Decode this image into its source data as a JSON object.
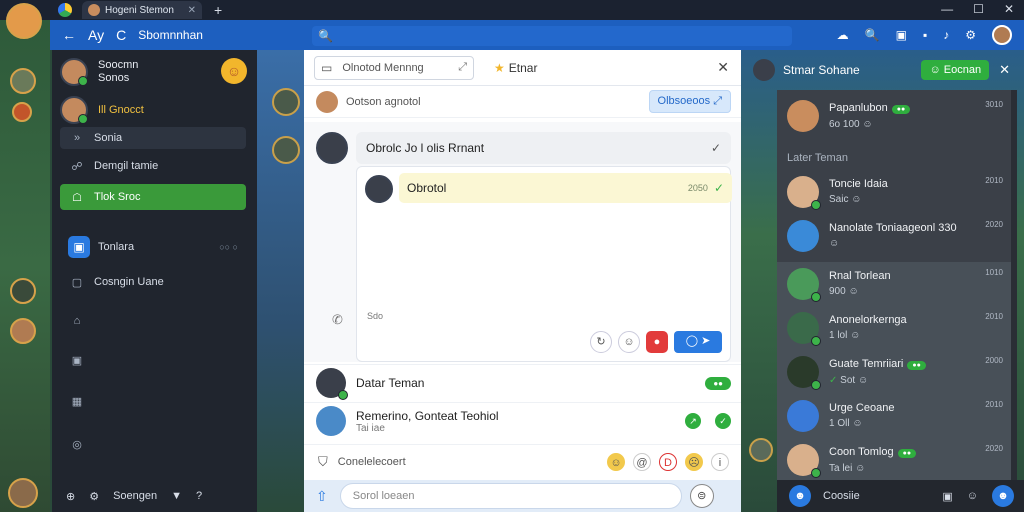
{
  "titlebar": {
    "tab_title": "Hogeni Stemon",
    "tab_close": "✕",
    "new_tab": "+",
    "controls": [
      "—",
      "☐",
      "✕"
    ]
  },
  "navbar": {
    "back": "←",
    "title_prefix": "Ay",
    "refresh": "C",
    "title": "Sbomnnhan",
    "search_icon": "🔍",
    "right_icons": [
      "☁",
      "🔍",
      "▣",
      "▪",
      "▪",
      "♪",
      "⚙"
    ]
  },
  "sidebar": {
    "user_name_line1": "Soocmn",
    "user_name_line2": "Sonos",
    "status_label": "Ill Gnocct",
    "items": [
      {
        "label": "Sonia",
        "icon": "»"
      },
      {
        "label": "Demgil tamie",
        "icon": "☍"
      },
      {
        "label": "Tlok Sroc",
        "icon": "☖"
      },
      {
        "label": "Tonlara",
        "icon": "▣",
        "meta": "○○ ○"
      },
      {
        "label": "Cosngin Uane",
        "icon": "▢"
      }
    ],
    "bottom_label": "Soengen"
  },
  "chat": {
    "header_box": "Olnotod Mennng",
    "header_star": "Etnar",
    "subheader_text": "Ootson agnotol",
    "subheader_pill": "Olbsoeoos",
    "top_message": "Obrolc Jo l olis Rrnant",
    "reply_text": "Obrotol",
    "reply_time": "2050",
    "small_text": "Sdo",
    "friend_list_title": "Datar Teman",
    "friend2_name": "Remerino, Gonteat Teohiol",
    "friend2_sub": "Tai iae",
    "toolbar_label": "Conelelecoert",
    "input_placeholder": "Sorol loeaen"
  },
  "right_panel": {
    "title": "Stmar Sohane",
    "header_button": "Eocnan",
    "section_label": "Later Teman",
    "contacts": [
      {
        "name": "Papanlubon",
        "sub": "6o 100",
        "time": "3010"
      },
      {
        "name": "Toncie Idaia",
        "sub": "Saic",
        "time": "2010"
      },
      {
        "name": "Nanolate Toniaageonl 330",
        "sub": "",
        "time": "2020"
      },
      {
        "name": "Rnal Torlean",
        "sub": "900",
        "time": "1010"
      },
      {
        "name": "Anonelorkernga",
        "sub": "1 lol",
        "time": "2010"
      },
      {
        "name": "Guate Temriiari",
        "sub": "Sot",
        "time": "2000"
      },
      {
        "name": "Urge Ceoane",
        "sub": "1 Oll",
        "time": "2010"
      },
      {
        "name": "Coon Tomlog",
        "sub": "Ta lei",
        "time": "2020"
      }
    ],
    "bottom_label": "Coosiie"
  }
}
